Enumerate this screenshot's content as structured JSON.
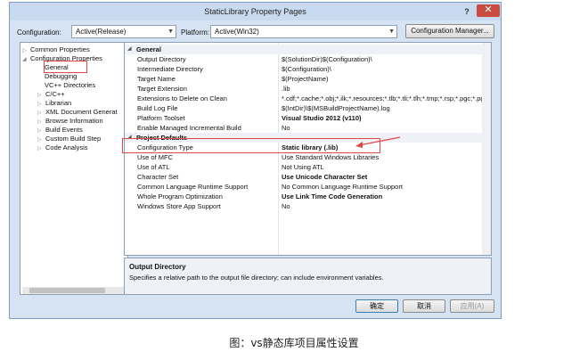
{
  "window": {
    "title": "StaticLibrary Property Pages",
    "help": "?",
    "close": "✕"
  },
  "toolbar": {
    "configuration_label": "Configuration:",
    "configuration_value": "Active(Release)",
    "platform_label": "Platform:",
    "platform_value": "Active(Win32)",
    "config_manager": "Configuration Manager..."
  },
  "tree": {
    "items": [
      "Common Properties",
      "Configuration Properties",
      "General",
      "Debugging",
      "VC++ Directories",
      "C/C++",
      "Librarian",
      "XML Document Generat",
      "Browse Information",
      "Build Events",
      "Custom Build Step",
      "Code Analysis"
    ]
  },
  "grid": {
    "sections": [
      "General",
      "Project Defaults"
    ],
    "general_rows": [
      {
        "name": "Output Directory",
        "value": "$(SolutionDir)$(Configuration)\\"
      },
      {
        "name": "Intermediate Directory",
        "value": "$(Configuration)\\"
      },
      {
        "name": "Target Name",
        "value": "$(ProjectName)"
      },
      {
        "name": "Target Extension",
        "value": ".lib"
      },
      {
        "name": "Extensions to Delete on Clean",
        "value": "*.cdf;*.cache;*.obj;*.ilk;*.resources;*.tlb;*.tli;*.tlh;*.tmp;*.rsp;*.pgc;*.pgd;*"
      },
      {
        "name": "Build Log File",
        "value": "$(IntDir)\\$(MSBuildProjectName).log"
      },
      {
        "name": "Platform Toolset",
        "value": "Visual Studio 2012 (v110)"
      },
      {
        "name": "Enable Managed Incremental Build",
        "value": "No"
      }
    ],
    "default_rows": [
      {
        "name": "Configuration Type",
        "value": "Static library (.lib)"
      },
      {
        "name": "Use of MFC",
        "value": "Use Standard Windows Libraries"
      },
      {
        "name": "Use of ATL",
        "value": "Not Using ATL"
      },
      {
        "name": "Character Set",
        "value": "Use Unicode Character Set"
      },
      {
        "name": "Common Language Runtime Support",
        "value": "No Common Language Runtime Support"
      },
      {
        "name": "Whole Program Optimization",
        "value": "Use Link Time Code Generation"
      },
      {
        "name": "Windows Store App Support",
        "value": "No"
      }
    ]
  },
  "description": {
    "title": "Output Directory",
    "text": "Specifies a relative path to the output file directory; can include environment variables."
  },
  "buttons": {
    "ok": "确定",
    "cancel": "取消",
    "apply": "应用(A)"
  },
  "caption": "图：vs静态库项目属性设置",
  "colors": {
    "highlight": "#e04848",
    "window_bg": "#d6e3f2"
  }
}
